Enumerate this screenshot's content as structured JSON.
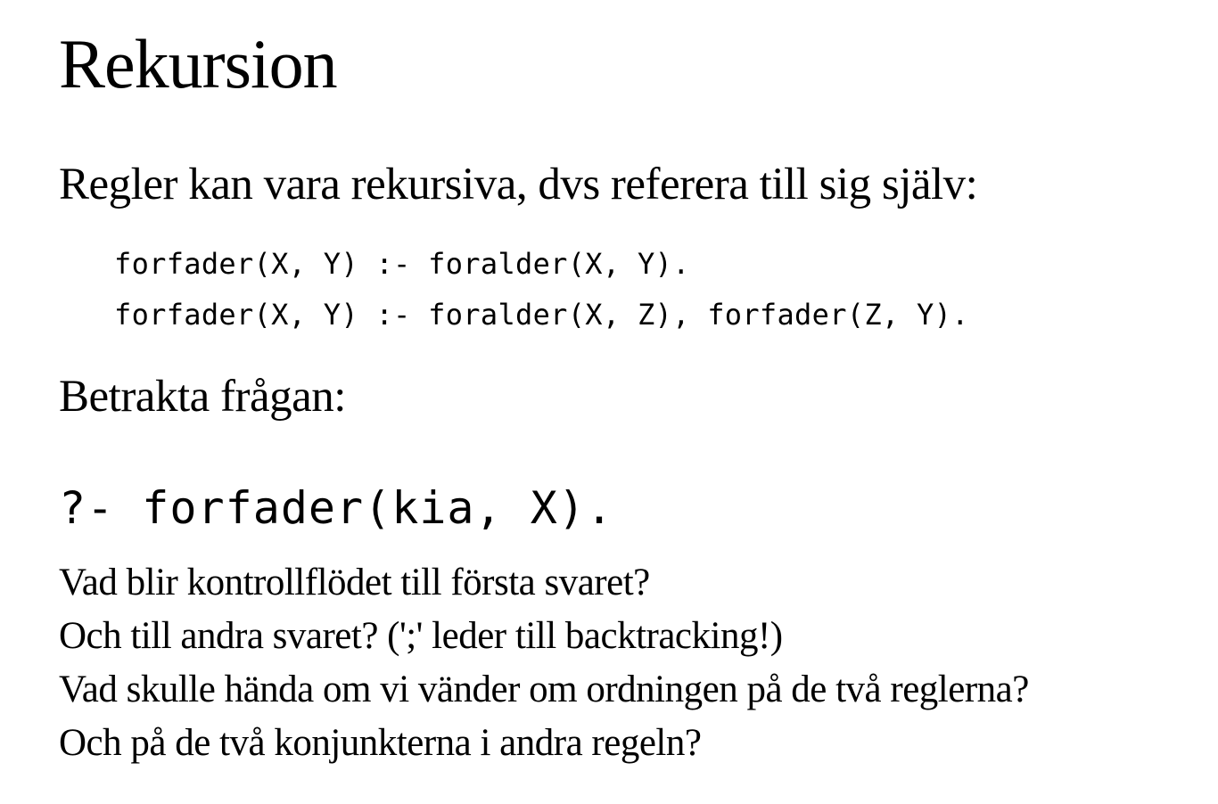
{
  "slide": {
    "title": "Rekursion",
    "intro": "Regler kan vara rekursiva, dvs referera till sig själv:",
    "code_lines": [
      "forfader(X, Y) :- foralder(X, Y).",
      "forfader(X, Y) :- foralder(X, Z), forfader(Z, Y)."
    ],
    "consider": "Betrakta frågan:",
    "query": "?- forfader(kia, X).",
    "questions": [
      "Vad blir kontrollflödet till första svaret?",
      "Och till andra svaret? (';' leder till backtracking!)",
      "Vad skulle hända om vi vänder om ordningen på de två reglerna?",
      "Och på de två konjunkterna i andra regeln?"
    ]
  }
}
